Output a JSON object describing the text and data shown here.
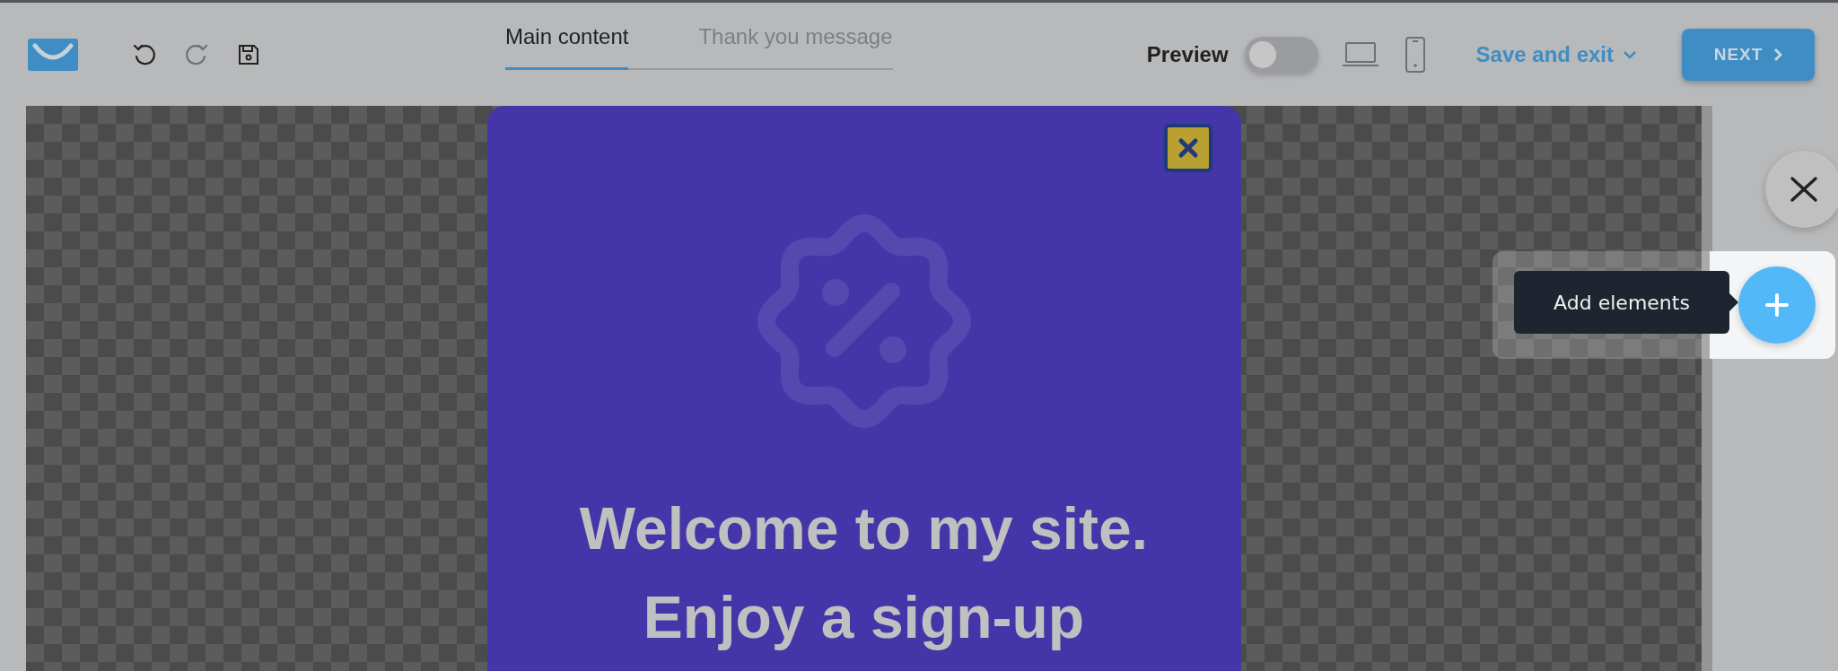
{
  "tabs": [
    {
      "label": "Main content",
      "selected": true
    },
    {
      "label": "Thank you message",
      "selected": false
    }
  ],
  "preview": {
    "label": "Preview",
    "on": false
  },
  "save_exit": {
    "label": "Save and exit"
  },
  "next_button": {
    "label": "NEXT"
  },
  "popup": {
    "heading_lines": [
      "Welcome to my site.",
      "Enjoy a sign-up"
    ]
  },
  "tooltip": {
    "text": "Add elements"
  }
}
